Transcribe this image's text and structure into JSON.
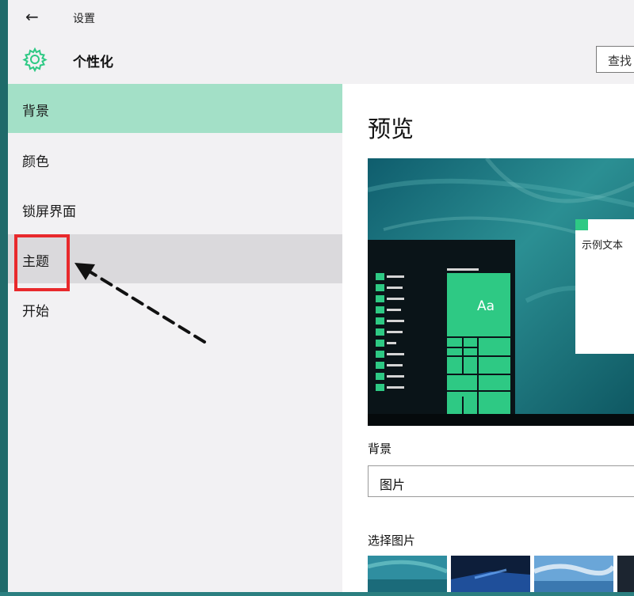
{
  "titlebar": {
    "back_icon": "←",
    "title": "设置"
  },
  "header": {
    "title": "个性化",
    "find_placeholder": "查找"
  },
  "nav": {
    "items": [
      {
        "label": "背景",
        "state": "selected"
      },
      {
        "label": "颜色",
        "state": "normal"
      },
      {
        "label": "锁屏界面",
        "state": "normal"
      },
      {
        "label": "主题",
        "state": "hovered"
      },
      {
        "label": "开始",
        "state": "normal"
      }
    ]
  },
  "content": {
    "preview_heading": "预览",
    "sample_text": "示例文本",
    "tile_text": "Aa",
    "background_label": "背景",
    "background_value": "图片",
    "choose_picture_label": "选择图片"
  },
  "colors": {
    "accent": "#2ec984",
    "selected_nav": "#a3e0c7",
    "annotation": "#e8292c"
  }
}
